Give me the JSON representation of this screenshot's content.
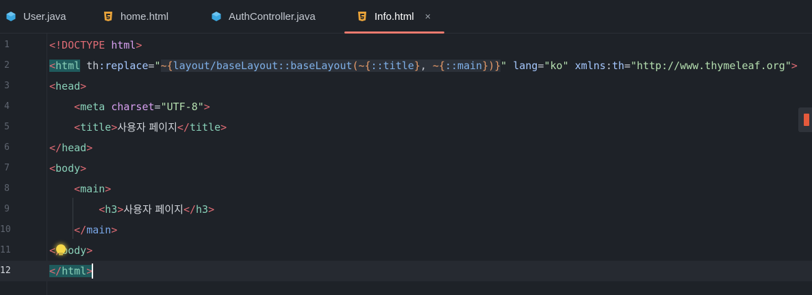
{
  "tabs": [
    {
      "label": "User.java",
      "icon": "java-class-icon",
      "active": false
    },
    {
      "label": "home.html",
      "icon": "html5-icon",
      "active": false
    },
    {
      "label": "AuthController.java",
      "icon": "java-class-icon",
      "active": false
    },
    {
      "label": "Info.html",
      "icon": "html5-icon",
      "active": true,
      "close": "×"
    }
  ],
  "colors": {
    "accent": "#f17b6f",
    "background": "#1e2228",
    "current_line": "#262a31"
  },
  "editor": {
    "current_line": 12,
    "line_numbers": [
      "1",
      "2",
      "3",
      "4",
      "5",
      "6",
      "7",
      "8",
      "9",
      "10",
      "11",
      "12"
    ],
    "lines": [
      "<!DOCTYPE html>",
      "<html th:replace=\"~{layout/baseLayout::baseLayout(~{::title}, ~{::main})}\" lang=\"ko\" xmlns:th=\"http://www.thymeleaf.org\">",
      "<head>",
      "    <meta charset=\"UTF-8\">",
      "    <title>사용자 페이지</title>",
      "</head>",
      "<body>",
      "    <main>",
      "        <h3>사용자 페이지</h3>",
      "    </main>",
      "</body>",
      "</html>"
    ]
  }
}
